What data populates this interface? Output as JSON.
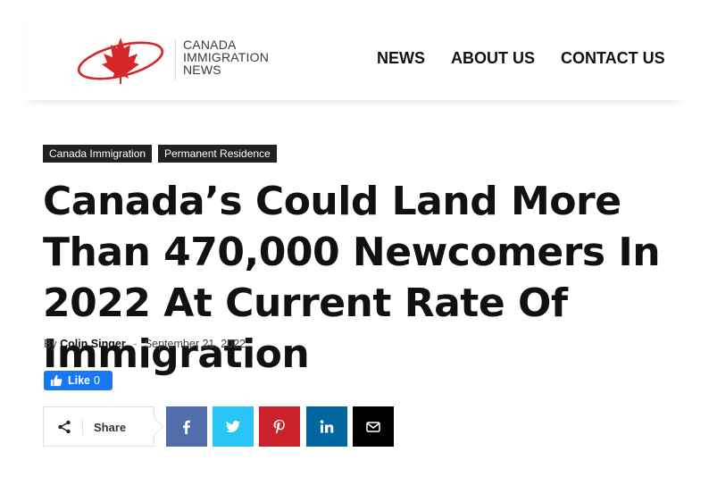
{
  "brand": {
    "logo_lines": [
      "CANADA",
      "IMMIGRATION",
      "NEWS"
    ],
    "colors": {
      "red": "#d62728",
      "dark_text": "#3a3a3a"
    }
  },
  "nav": {
    "items": [
      {
        "label": "NEWS"
      },
      {
        "label": "ABOUT US"
      },
      {
        "label": "CONTACT US"
      }
    ]
  },
  "article": {
    "categories": [
      "Canada Immigration",
      "Permanent Residence"
    ],
    "title": "Canada’s Could Land More Than 470,000 Newcomers In 2022 At Current Rate Of Immigration",
    "byline": {
      "by": "By",
      "author": "Colin Singer",
      "separator": "-",
      "date": "September 21, 2022"
    }
  },
  "facebook_like": {
    "label": "Like",
    "count": "0",
    "color": "#1877f2"
  },
  "share": {
    "label": "Share",
    "icon": "share-icon",
    "buttons": [
      {
        "network": "facebook",
        "icon": "facebook-icon",
        "color": "#516eab"
      },
      {
        "network": "twitter",
        "icon": "twitter-icon",
        "color": "#29c5f6"
      },
      {
        "network": "pinterest",
        "icon": "pinterest-icon",
        "color": "#ca212a"
      },
      {
        "network": "linkedin",
        "icon": "linkedin-icon",
        "color": "#0266a0"
      },
      {
        "network": "email",
        "icon": "envelope-icon",
        "color": "#000000"
      }
    ]
  }
}
